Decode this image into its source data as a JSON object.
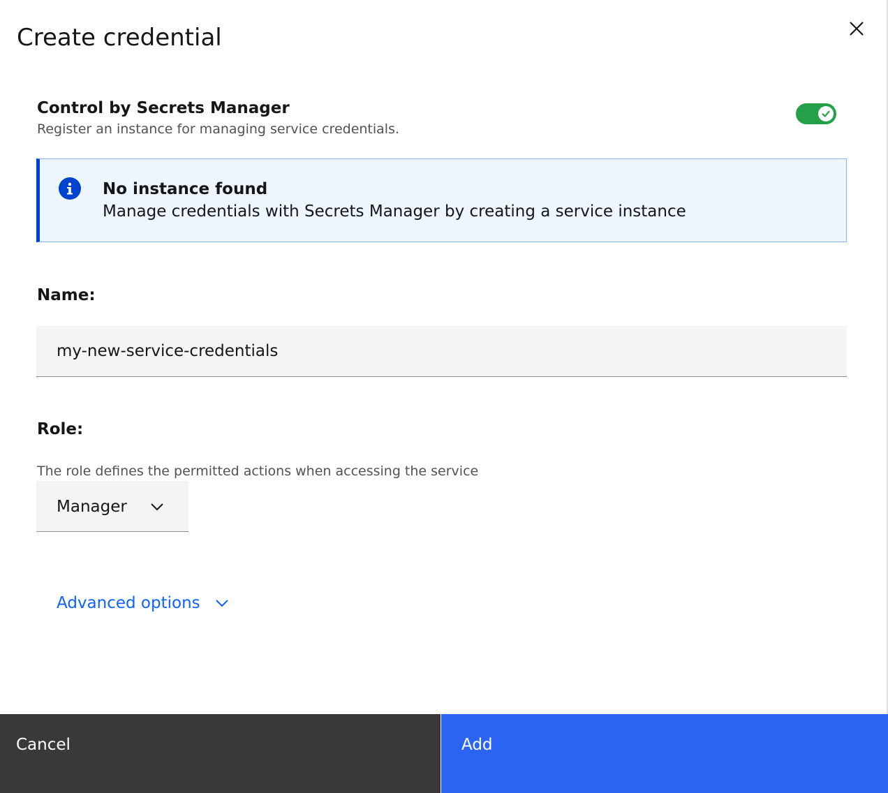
{
  "modal": {
    "title": "Create credential"
  },
  "secrets_manager": {
    "title": "Control by Secrets Manager",
    "description": "Register an instance for managing service credentials.",
    "toggle_on": true,
    "toggle_color": "#24a148"
  },
  "notification": {
    "type": "info",
    "title": "No instance found",
    "subtitle": "Manage credentials with Secrets Manager by creating a service instance",
    "accent_color": "#0043ce"
  },
  "name_field": {
    "label": "Name:",
    "value": "my-new-service-credentials"
  },
  "role_field": {
    "label": "Role:",
    "helper": "The role defines the permitted actions when accessing the service",
    "selected": "Manager"
  },
  "advanced": {
    "label": "Advanced options",
    "link_color": "#0f62fe"
  },
  "footer": {
    "cancel_label": "Cancel",
    "add_label": "Add",
    "primary_color": "#2b63f2"
  }
}
